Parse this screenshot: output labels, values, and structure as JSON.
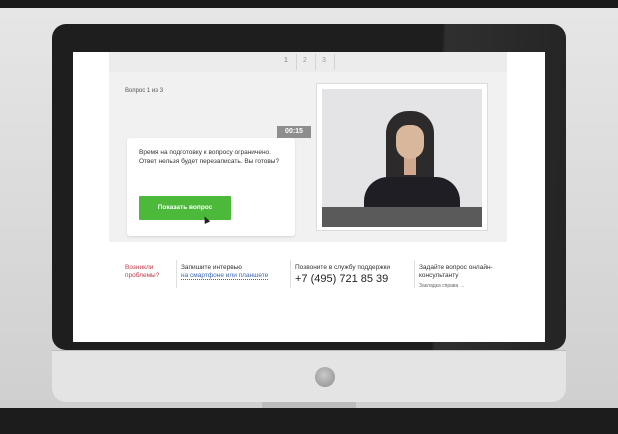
{
  "steps": [
    "1",
    "2",
    "3"
  ],
  "question": {
    "label": "Вопрос 1 из 3",
    "timer": "00:15",
    "message": "Время на подготовку к вопросу ограничено. Ответ нельзя будет перезаписать. Вы готовы?",
    "button_label": "Показать вопрос"
  },
  "footer": {
    "problems": "Возникли проблемы?",
    "record_title": "Запишите интервью",
    "record_link": "на смартфоне или планшете",
    "support_title": "Позвоните в службу поддержки",
    "support_phone": "+7 (495) 721 85 39",
    "ask_title": "Задайте вопрос онлайн-консультанту",
    "ask_link": "Закладка справа →"
  },
  "colors": {
    "accent_green": "#4cb93a",
    "problem_red": "#c03b4a",
    "link_blue": "#3b67b7"
  }
}
